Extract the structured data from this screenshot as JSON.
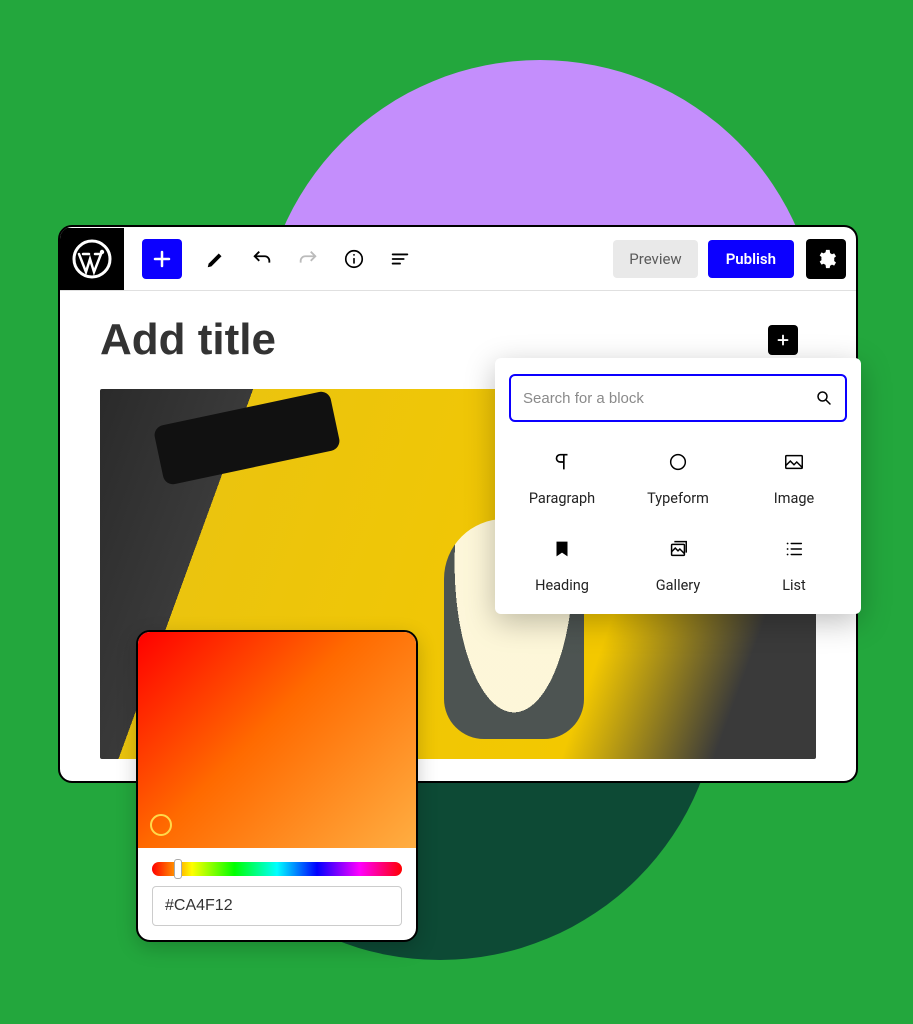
{
  "toolbar": {
    "preview_label": "Preview",
    "publish_label": "Publish"
  },
  "editor": {
    "title_placeholder": "Add title"
  },
  "inserter": {
    "search_placeholder": "Search for a block",
    "blocks": [
      {
        "id": "paragraph",
        "label": "Paragraph"
      },
      {
        "id": "typeform",
        "label": "Typeform"
      },
      {
        "id": "image",
        "label": "Image"
      },
      {
        "id": "heading",
        "label": "Heading"
      },
      {
        "id": "gallery",
        "label": "Gallery"
      },
      {
        "id": "list",
        "label": "List"
      }
    ]
  },
  "color_picker": {
    "hex": "#CA4F12"
  }
}
